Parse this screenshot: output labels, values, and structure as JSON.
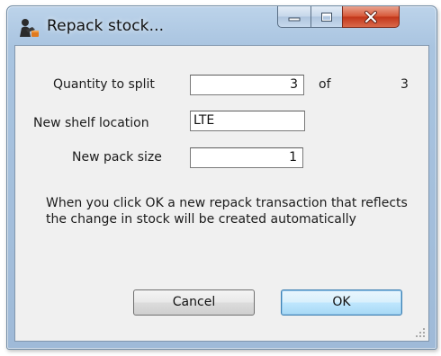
{
  "window": {
    "title": "Repack stock..."
  },
  "form": {
    "quantity_label": "Quantity to split",
    "quantity_value": "3",
    "of_label": "of",
    "of_value": "3",
    "location_label": "New shelf location",
    "location_value": "LTE",
    "pack_size_label": "New pack size",
    "pack_size_value": "1"
  },
  "message": "When you click OK a new repack transaction that reflects the change in stock will be created automatically",
  "buttons": {
    "cancel": "Cancel",
    "ok": "OK"
  },
  "icons": {
    "app": "repack-stock-icon",
    "minimize": "minimize-icon",
    "maximize": "maximize-icon",
    "close": "close-icon",
    "grip": "resize-grip-icon"
  }
}
